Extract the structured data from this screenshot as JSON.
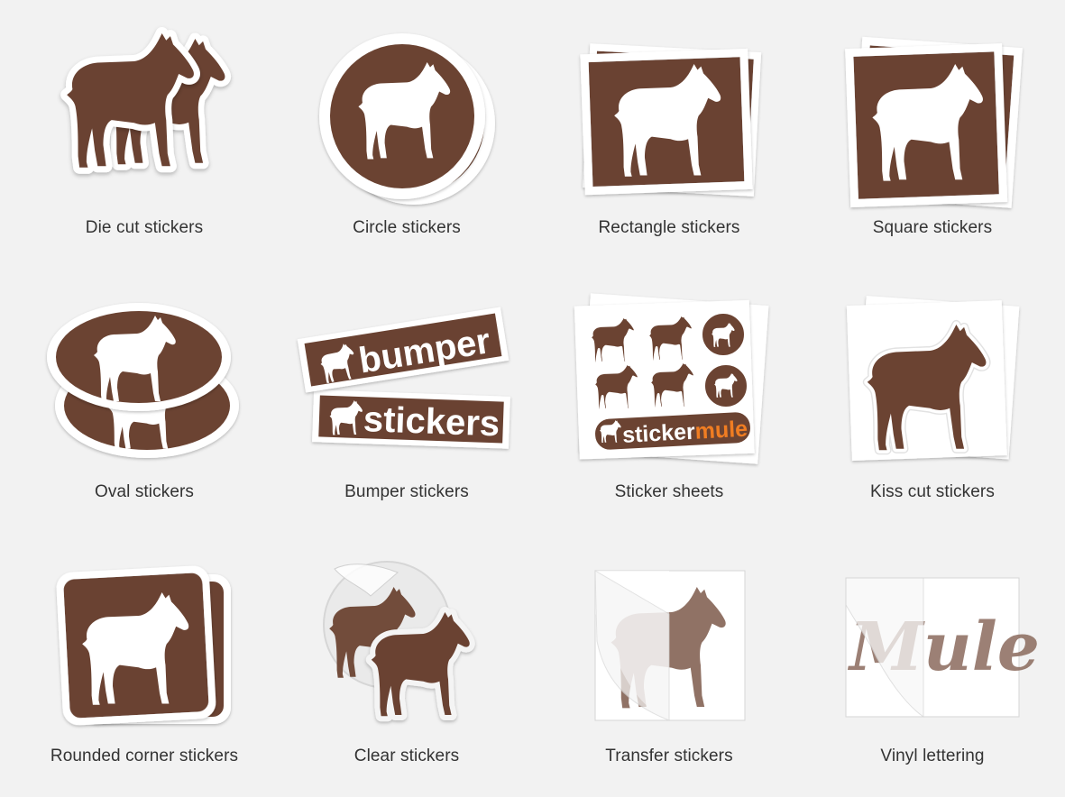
{
  "colors": {
    "background": "#f2f2f2",
    "brown": "#6b4332",
    "white": "#ffffff",
    "label": "#333333",
    "orange": "#f07d22"
  },
  "products": [
    {
      "id": "die-cut",
      "label": "Die cut stickers",
      "icon": "horse-die-cut-icon"
    },
    {
      "id": "circle",
      "label": "Circle stickers",
      "icon": "horse-circle-icon"
    },
    {
      "id": "rectangle",
      "label": "Rectangle stickers",
      "icon": "horse-rectangle-icon"
    },
    {
      "id": "square",
      "label": "Square stickers",
      "icon": "horse-square-icon"
    },
    {
      "id": "oval",
      "label": "Oval stickers",
      "icon": "horse-oval-icon"
    },
    {
      "id": "bumper",
      "label": "Bumper stickers",
      "icon": "bumper-sticker-icon",
      "art_text": [
        "bumper",
        "stickers"
      ]
    },
    {
      "id": "sheets",
      "label": "Sticker sheets",
      "icon": "sticker-sheet-icon",
      "art_text": [
        "sticker",
        "mule"
      ]
    },
    {
      "id": "kiss-cut",
      "label": "Kiss cut stickers",
      "icon": "horse-kiss-cut-icon"
    },
    {
      "id": "rounded",
      "label": "Rounded corner stickers",
      "icon": "horse-rounded-icon"
    },
    {
      "id": "clear",
      "label": "Clear stickers",
      "icon": "horse-clear-icon"
    },
    {
      "id": "transfer",
      "label": "Transfer stickers",
      "icon": "horse-transfer-icon"
    },
    {
      "id": "vinyl",
      "label": "Vinyl lettering",
      "icon": "vinyl-lettering-icon",
      "art_text": [
        "Mule"
      ]
    }
  ]
}
